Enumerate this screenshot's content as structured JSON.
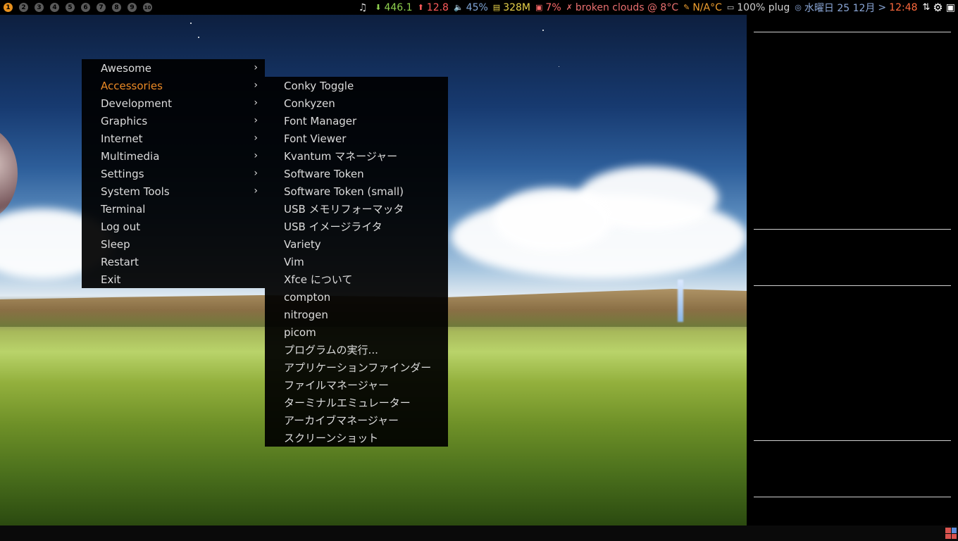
{
  "taglist": [
    "1",
    "2",
    "3",
    "4",
    "5",
    "6",
    "7",
    "8",
    "9",
    "10"
  ],
  "active_tag": "1",
  "widgets": {
    "music_icon": "music-note-icon",
    "net_down": "446.1",
    "net_up": "12.8",
    "volume": "45%",
    "memory": "328M",
    "cpu": "7%",
    "weather": "broken clouds @ 8°C",
    "temp": "N/A°C",
    "battery": "100% plug",
    "date": "水曜日 25 12月",
    "time_sep": ">",
    "time": "12:48"
  },
  "colors": {
    "net_down": "#8fd14f",
    "net_up": "#ff5b5b",
    "volume": "#7fa6d9",
    "memory": "#e8d24a",
    "cpu": "#ff6b6b",
    "weather": "#e86f6f",
    "temp": "#f0a030",
    "battery": "#cfcfcf",
    "date": "#8aa6d6",
    "time": "#ff6a3d",
    "menu_active": "#ec8a25"
  },
  "main_menu": [
    {
      "label": "Awesome",
      "submenu": true
    },
    {
      "label": "Accessories",
      "submenu": true,
      "active": true
    },
    {
      "label": "Development",
      "submenu": true
    },
    {
      "label": "Graphics",
      "submenu": true
    },
    {
      "label": "Internet",
      "submenu": true
    },
    {
      "label": "Multimedia",
      "submenu": true
    },
    {
      "label": "Settings",
      "submenu": true
    },
    {
      "label": "System Tools",
      "submenu": true
    },
    {
      "label": "Terminal",
      "submenu": false
    },
    {
      "label": "Log out",
      "submenu": false
    },
    {
      "label": "Sleep",
      "submenu": false
    },
    {
      "label": "Restart",
      "submenu": false
    },
    {
      "label": "Exit",
      "submenu": false
    }
  ],
  "accessories_menu": [
    "Conky Toggle",
    "Conkyzen",
    "Font Manager",
    "Font Viewer",
    "Kvantum マネージャー",
    "Software Token",
    "Software Token (small)",
    "USB メモリフォーマッタ",
    "USB イメージライタ",
    "Variety",
    "Vim",
    "Xfce について",
    "compton",
    "nitrogen",
    "picom",
    "プログラムの実行...",
    "アプリケーションファインダー",
    "ファイルマネージャー",
    "ターミナルエミュレーター",
    "アーカイブマネージャー",
    "スクリーンショット"
  ],
  "submenu_arrow": "›"
}
